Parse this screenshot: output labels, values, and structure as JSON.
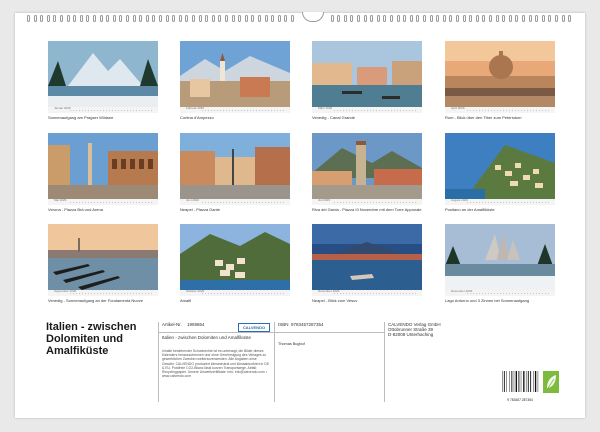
{
  "calendar": {
    "title": "Italien - zwischen Dolomiten und Amalfiküste",
    "photos": [
      {
        "month": "Januar 2026",
        "caption": "Sonnenaufgang am Pragser Wildsee",
        "scene": "alpine-lake"
      },
      {
        "month": "Februar 2026",
        "caption": "Cortina d'Ampezzo",
        "scene": "mountain-town"
      },
      {
        "month": "März 2026",
        "caption": "Venedig - Canal Grande",
        "scene": "venice-canal"
      },
      {
        "month": "April 2026",
        "caption": "Rom - Blick über den Tiber zum Petersdom",
        "scene": "rome-dome"
      },
      {
        "month": "Mai 2026",
        "caption": "Verona - Piazza Brà und Arena",
        "scene": "verona-arena"
      },
      {
        "month": "Juni 2026",
        "caption": "Neapel - Piazza Dante",
        "scene": "naples-piazza"
      },
      {
        "month": "Juli 2026",
        "caption": "Riva del Garda - Piazza III Novembre mit dem Torre Apponale",
        "scene": "riva-tower"
      },
      {
        "month": "August 2026",
        "caption": "Positano an der Amalfiküste",
        "scene": "positano"
      },
      {
        "month": "September 2026",
        "caption": "Venedig - Sonnenaufgang an der Fondamenta Nuove",
        "scene": "venice-gondolas"
      },
      {
        "month": "Oktober 2026",
        "caption": "Amalfi",
        "scene": "amalfi"
      },
      {
        "month": "November 2026",
        "caption": "Neapel - Blick zum Vesuv",
        "scene": "naples-vesuvius"
      },
      {
        "month": "Dezember 2026",
        "caption": "Lago Antorno und 3 Zinnen bei Sonnenaufgang",
        "scene": "three-peaks"
      }
    ]
  },
  "info": {
    "article_label": "Artikel-Nr.",
    "article_no": "1959864",
    "isbn_label": "ISBN",
    "isbn": "9783457287354",
    "publisher_lines": [
      "CALVENDO Verlag GmbH",
      "Ottobrunner Straße 39",
      "D-82008 Unterhaching"
    ],
    "logo_text": "CALVENDO",
    "short_title": "Italien - zwischen Dolomiten und Amalfiküste",
    "author": "Thomas Bugbuf",
    "legal": "Inhalte bestehender Schutzrechte ist es untersagt, die Bilder dieses Kalenders herauszutrennen und ohne Genehmigung des Verlages zu gewerblichen Zwecken weiterzuverwenden. Alle Angaben ohne Gewähr. CALVENDO produziert klimaneutral und klimaabsorbiert in DE & EU. Postfreie CO2-Bilanz lässt kurzen Transportwege. Abfall: Recyclingpapier. Unsere Umweltzertifikate: Info: info@calvendo.com • www.calvendo.com",
    "barcode_number": "9 783457 287354"
  },
  "colors": {
    "sheet": "#ffffff",
    "background": "#e9e9e9",
    "brand_blue": "#2a6db5",
    "eco_green": "#7dbb3c"
  }
}
